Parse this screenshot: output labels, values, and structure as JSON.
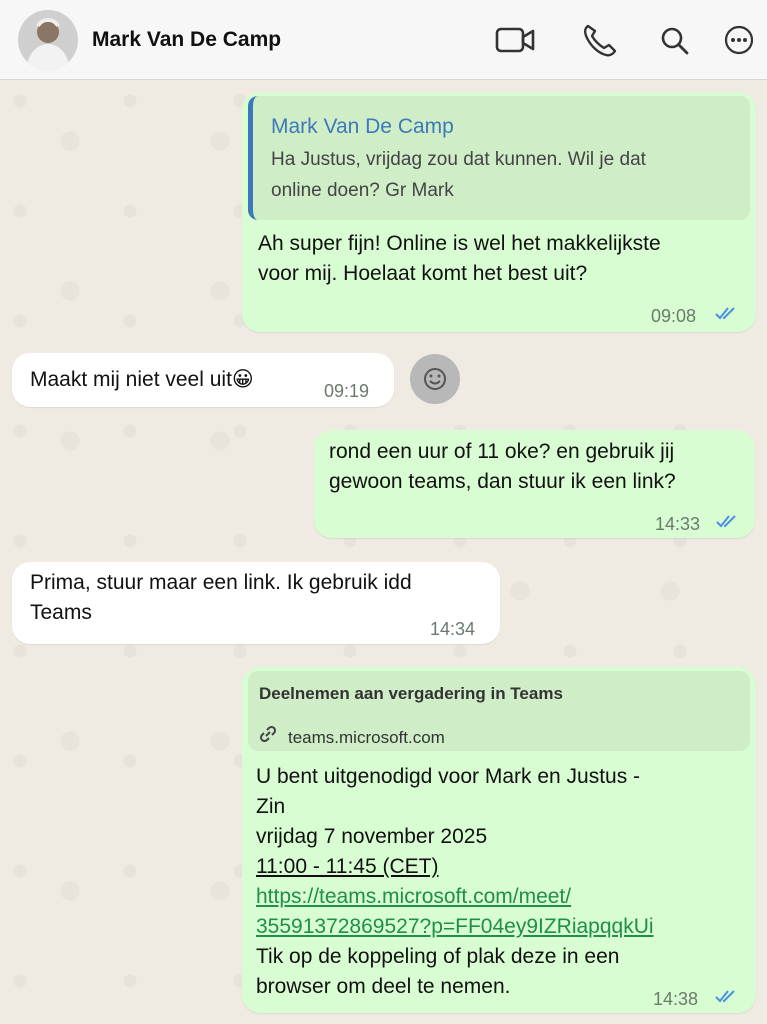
{
  "header": {
    "contact_name": "Mark Van De Camp"
  },
  "icons": {
    "video": "video-camera-icon",
    "call": "phone-icon",
    "search": "search-icon",
    "more": "more-options-icon"
  },
  "colors": {
    "outgoing_bubble": "#d9fdd3",
    "incoming_bubble": "#ffffff",
    "quote_accent": "#3d79b8",
    "link": "#1f8f4a",
    "read_ticks": "#4a90e2"
  },
  "messages": [
    {
      "direction": "out",
      "quote": {
        "author": "Mark Van De Camp",
        "text_line1": "Ha Justus, vrijdag zou dat kunnen. Wil je dat",
        "text_line2": "online doen? Gr Mark"
      },
      "line1": "Ah super fijn! Online is wel het makkelijkste",
      "line2": "voor mij. Hoelaat komt het best uit?",
      "time": "09:08",
      "status": "read"
    },
    {
      "direction": "in",
      "text": "Maakt mij niet veel uit😀",
      "time": "09:19"
    },
    {
      "direction": "out",
      "line1": "rond een uur of 11 oke? en gebruik jij",
      "line2": "gewoon teams, dan stuur ik een link?",
      "time": "14:33",
      "status": "read"
    },
    {
      "direction": "in",
      "line1": "Prima, stuur maar een link. Ik gebruik idd",
      "line2": "Teams",
      "time": "14:34"
    },
    {
      "direction": "out",
      "preview_title": "Deelnemen aan vergadering in Teams",
      "preview_domain": "teams.microsoft.com",
      "line1": "U bent uitgenodigd voor Mark en Justus -",
      "line2": "Zin",
      "line3": "vrijdag 7 november 2025",
      "line4": "11:00 - 11:45 (CET)",
      "link_line1": "https://teams.microsoft.com/meet/",
      "link_line2": "35591372869527?p=FF04ey9IZRiapqqkUi",
      "line5": "Tik op de koppeling of plak deze in een",
      "line6": "browser om deel te nemen.",
      "time": "14:38",
      "status": "read"
    }
  ]
}
